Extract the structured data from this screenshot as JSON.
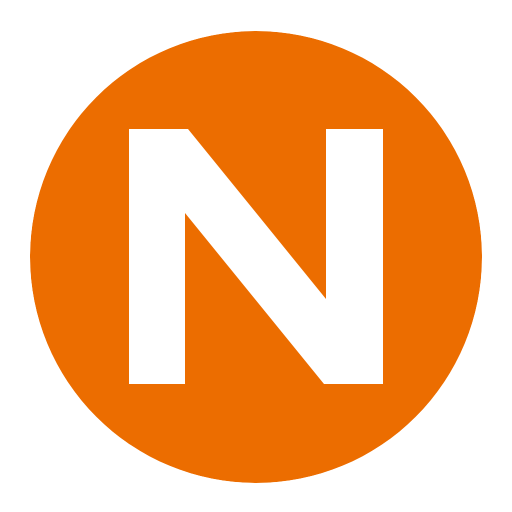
{
  "logo": {
    "icon": "letter-n-logo-icon",
    "letter": "N",
    "colors": {
      "circle": "#EC6D00",
      "letter": "#FFFFFF",
      "background": "#FFFFFF"
    }
  }
}
